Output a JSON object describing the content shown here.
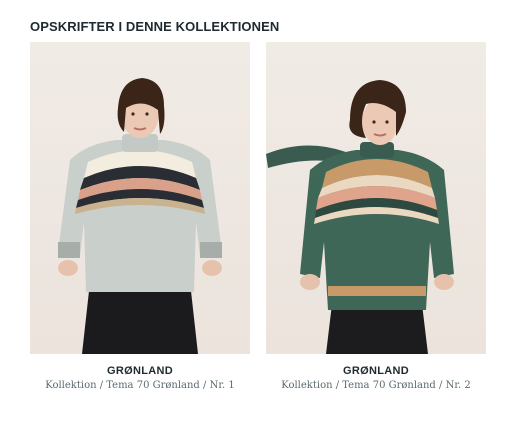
{
  "section": {
    "title": "OPSKRIFTER I DENNE KOLLEKTIONEN"
  },
  "recipes": [
    {
      "title": "GRØNLAND",
      "subtitle": "Kollektion / Tema 70 Grønland / Nr. 1",
      "image": "model-grey-fair-isle-sweater",
      "sweater_color": "#c9cfcb",
      "yoke_colors": [
        "#f3ede0",
        "#2a2d33",
        "#d9a08a",
        "#c9b38e"
      ]
    },
    {
      "title": "GRØNLAND",
      "subtitle": "Kollektion / Tema 70 Grønland / Nr. 2",
      "image": "model-green-fair-isle-sweater",
      "sweater_color": "#3f6758",
      "yoke_colors": [
        "#c89a6a",
        "#ead8c0",
        "#e0a48c",
        "#2e4a40"
      ]
    }
  ]
}
